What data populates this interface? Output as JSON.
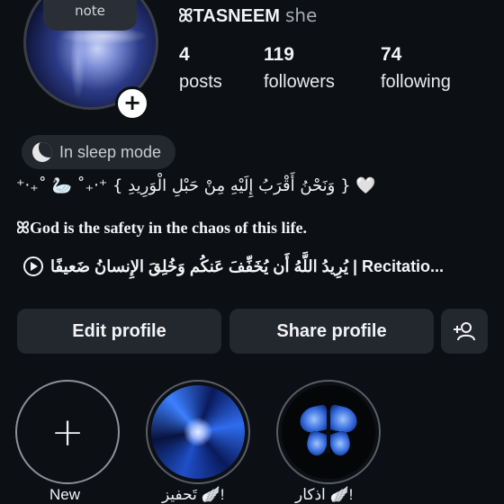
{
  "profile": {
    "note": "note",
    "symbol": "ꕤ",
    "username": "TASNEEM",
    "pronouns": "she",
    "stats": [
      {
        "value": "4",
        "label": "posts"
      },
      {
        "value": "119",
        "label": "followers"
      },
      {
        "value": "74",
        "label": "following"
      }
    ]
  },
  "status": {
    "sleep_text": "In sleep mode"
  },
  "bio": {
    "line1": "⁺‧₊˚ 🦢 ˚₊‧⁺ { وَنَحْنُ أَقْرَبُ إِلَيْهِ مِنْ حَبْلِ الْوَرِيدِ } 🤍",
    "line2": "ꕤGod is the safety in the chaos of this life.",
    "music": "يُرِيدُ اللَّهُ أَن يُخَفِّفَ عَنكُم وَخُلِقَ الإِنسانُ ضَعيفًا | Recitatio..."
  },
  "actions": {
    "edit_profile": "Edit profile",
    "share_profile": "Share profile"
  },
  "highlights": [
    {
      "label": "New",
      "icon": "plus-icon"
    },
    {
      "label": "تَحفيز 🪽!",
      "icon": "galaxy-image"
    },
    {
      "label": "اذكار 🪽!",
      "icon": "butterfly-image"
    }
  ],
  "colors": {
    "background": "#0c0f14",
    "button": "#23272e",
    "text": "#f2f3f5",
    "muted": "#a7abb2"
  }
}
